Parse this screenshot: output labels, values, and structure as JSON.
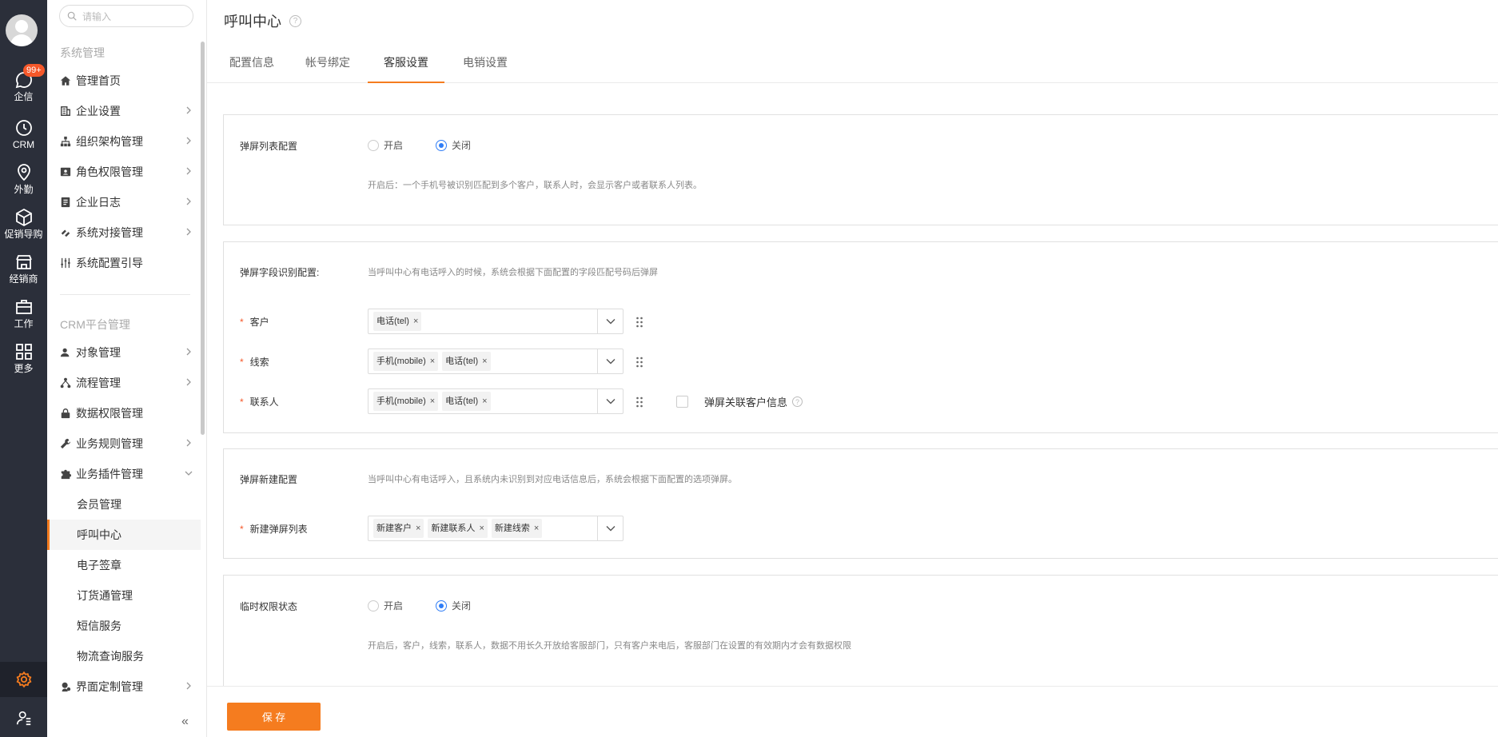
{
  "rail": {
    "badge": "99+",
    "items": [
      {
        "label": "企信",
        "icon": "chat-icon"
      },
      {
        "label": "CRM",
        "icon": "clock-icon"
      },
      {
        "label": "外勤",
        "icon": "location-pin-icon"
      },
      {
        "label": "促销导购",
        "icon": "box-icon"
      },
      {
        "label": "经销商",
        "icon": "store-icon"
      },
      {
        "label": "工作",
        "icon": "briefcase-icon"
      },
      {
        "label": "更多",
        "icon": "grid-icon"
      }
    ]
  },
  "sidebar": {
    "search_placeholder": "请输入",
    "group1_title": "系统管理",
    "group1": [
      "管理首页",
      "企业设置",
      "组织架构管理",
      "角色权限管理",
      "企业日志",
      "系统对接管理",
      "系统配置引导"
    ],
    "group2_title": "CRM平台管理",
    "group2": [
      "对象管理",
      "流程管理",
      "数据权限管理",
      "业务规则管理",
      "业务插件管理"
    ],
    "subitems": [
      "会员管理",
      "呼叫中心",
      "电子签章",
      "订货通管理",
      "短信服务",
      "物流查询服务"
    ],
    "last_item": "界面定制管理",
    "collapse": "«"
  },
  "page": {
    "title": "呼叫中心",
    "help": "?",
    "tabs": [
      "配置信息",
      "帐号绑定",
      "客服设置",
      "电销设置"
    ]
  },
  "section1": {
    "label": "弹屏列表配置",
    "open": "开启",
    "close": "关闭",
    "selected": "关闭",
    "hint": "开启后：一个手机号被识别匹配到多个客户，联系人时，会显示客户或者联系人列表。"
  },
  "section2": {
    "label": "弹屏字段识别配置:",
    "hint": "当呼叫中心有电话呼入的时候，系统会根据下面配置的字段匹配号码后弹屏",
    "rows": [
      {
        "label": "客户",
        "tags": [
          "电话(tel)"
        ]
      },
      {
        "label": "线索",
        "tags": [
          "手机(mobile)",
          "电话(tel)"
        ]
      },
      {
        "label": "联系人",
        "tags": [
          "手机(mobile)",
          "电话(tel)"
        ]
      }
    ],
    "checkbox_label": "弹屏关联客户信息",
    "required_mark": "*",
    "tag_close": "×"
  },
  "section3": {
    "label": "弹屏新建配置",
    "hint": "当呼叫中心有电话呼入，且系统内未识别到对应电话信息后，系统会根据下面配置的选项弹屏。",
    "row_label": "新建弹屏列表",
    "tags": [
      "新建客户",
      "新建联系人",
      "新建线索"
    ]
  },
  "section4": {
    "label": "临时权限状态",
    "open": "开启",
    "close": "关闭",
    "selected": "关闭",
    "hint": "开启后，客户，线索，联系人，数据不用长久开放给客服部门，只有客户来电后，客服部门在设置的有效期内才会有数据权限"
  },
  "footer": {
    "save": "保 存"
  },
  "colors": {
    "accent": "#f57c1f",
    "rail": "#2b2f3a",
    "radio": "#2f7df6",
    "badge": "#f5582a"
  }
}
